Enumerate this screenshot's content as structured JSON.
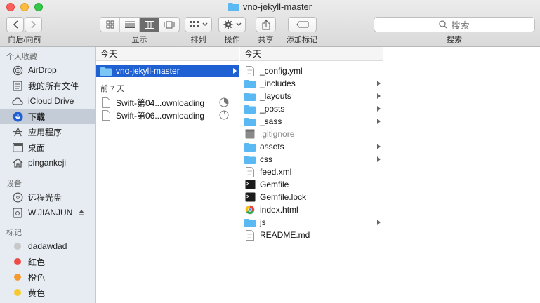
{
  "window": {
    "title": "vno-jekyll-master"
  },
  "toolbar": {
    "nav_label": "向后/向前",
    "view_label": "显示",
    "arrange_label": "排列",
    "action_label": "操作",
    "share_label": "共享",
    "tags_label": "添加标记",
    "search_label": "搜索",
    "search_placeholder": "搜索"
  },
  "sidebar": {
    "favorites_header": "个人收藏",
    "favorites": [
      {
        "label": "AirDrop",
        "icon": "airdrop-icon"
      },
      {
        "label": "我的所有文件",
        "icon": "all-files-icon"
      },
      {
        "label": "iCloud Drive",
        "icon": "cloud-icon"
      },
      {
        "label": "下载",
        "icon": "download-icon"
      },
      {
        "label": "应用程序",
        "icon": "applications-icon"
      },
      {
        "label": "桌面",
        "icon": "desktop-icon"
      },
      {
        "label": "pingankeji",
        "icon": "home-icon"
      }
    ],
    "devices_header": "设备",
    "devices": [
      {
        "label": "远程光盘",
        "icon": "disc-icon"
      },
      {
        "label": "W.JIANJUN",
        "icon": "drive-icon"
      }
    ],
    "tags_header": "标记",
    "tags": [
      {
        "label": "dadawdad",
        "color": "#c8c8c8"
      },
      {
        "label": "红色",
        "color": "#f04a45"
      },
      {
        "label": "橙色",
        "color": "#f69a2e"
      },
      {
        "label": "黄色",
        "color": "#f7c92e"
      }
    ]
  },
  "column1": {
    "header": "今天",
    "today_items": [
      {
        "label": "vno-jekyll-master"
      }
    ],
    "week_header": "前 7 天",
    "week_items": [
      {
        "label": "Swift-第04...ownloading"
      },
      {
        "label": "Swift-第06...ownloading"
      }
    ]
  },
  "column2": {
    "header": "今天",
    "items": [
      {
        "label": "_config.yml",
        "kind": "file"
      },
      {
        "label": "_includes",
        "kind": "folder"
      },
      {
        "label": "_layouts",
        "kind": "folder"
      },
      {
        "label": "_posts",
        "kind": "folder"
      },
      {
        "label": "_sass",
        "kind": "folder"
      },
      {
        "label": ".gitignore",
        "kind": "hidden"
      },
      {
        "label": "assets",
        "kind": "folder"
      },
      {
        "label": "css",
        "kind": "folder"
      },
      {
        "label": "feed.xml",
        "kind": "file"
      },
      {
        "label": "Gemfile",
        "kind": "exec"
      },
      {
        "label": "Gemfile.lock",
        "kind": "exec"
      },
      {
        "label": "index.html",
        "kind": "html"
      },
      {
        "label": "js",
        "kind": "folder"
      },
      {
        "label": "README.md",
        "kind": "file"
      }
    ]
  },
  "colors": {
    "selection": "#1f60d3",
    "folder": "#5ab8f2",
    "sidebar": "#e6ecf2"
  }
}
